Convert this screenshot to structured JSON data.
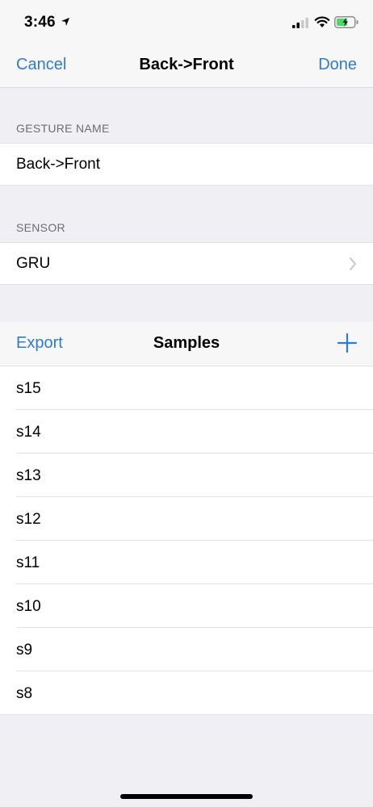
{
  "status_bar": {
    "time": "3:46",
    "icons": [
      "location-arrow-icon",
      "cellular-signal-icon",
      "wifi-icon",
      "battery-charging-icon"
    ]
  },
  "nav": {
    "cancel_label": "Cancel",
    "title": "Back->Front",
    "done_label": "Done"
  },
  "gesture_section": {
    "header": "GESTURE NAME",
    "value": "Back->Front"
  },
  "sensor_section": {
    "header": "SENSOR",
    "value": "GRU"
  },
  "samples": {
    "export_label": "Export",
    "title": "Samples",
    "add_icon": "plus-icon",
    "items": [
      "s15",
      "s14",
      "s13",
      "s12",
      "s11",
      "s10",
      "s9",
      "s8"
    ]
  },
  "colors": {
    "accent": "#2f7bd2",
    "background": "#efeff4",
    "bar": "#f7f7f7",
    "battery_charging": "#4cd964"
  }
}
